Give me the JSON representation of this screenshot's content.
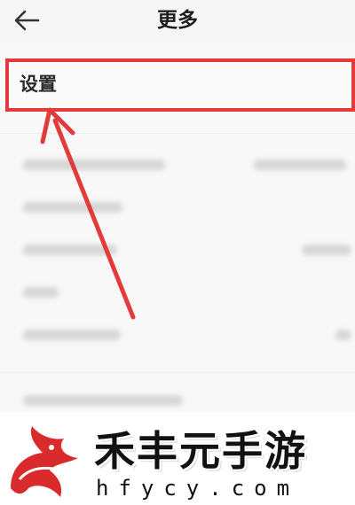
{
  "header": {
    "title": "更多",
    "back_icon": "arrow-left-icon"
  },
  "menu": {
    "settings_label": "设置"
  },
  "watermark": {
    "brand_text": "禾丰元手游",
    "url_text": "hfycy.com"
  },
  "colors": {
    "annotation": "#e23b3b",
    "background": "#f3f3f3"
  }
}
